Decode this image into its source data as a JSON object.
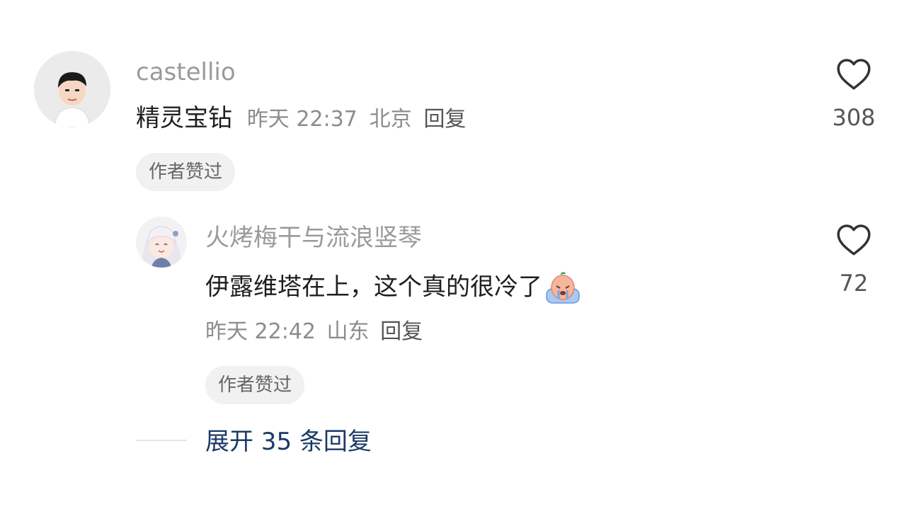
{
  "comment": {
    "username": "castellio",
    "text": "精灵宝钻",
    "time": "昨天 22:37",
    "location": "北京",
    "reply_label": "回复",
    "badge": "作者赞过",
    "likes": "308",
    "avatar_icon": "boy-avatar-icon",
    "like_icon": "heart-icon"
  },
  "reply": {
    "username": "火烤梅干与流浪竖琴",
    "text": "伊露维塔在上，这个真的很冷了",
    "emoji_icon": "crying-emoji-icon",
    "time": "昨天 22:42",
    "location": "山东",
    "reply_label": "回复",
    "badge": "作者赞过",
    "likes": "72",
    "avatar_icon": "anime-girl-avatar-icon",
    "like_icon": "heart-icon"
  },
  "expand": {
    "label": "展开 35 条回复"
  },
  "colors": {
    "background": "#ffffff",
    "username": "#9a9a9a",
    "content": "#1f1f1f",
    "meta": "#8c8c8c",
    "badge_bg": "#f1f1f1",
    "expand_link": "#1b3a66"
  }
}
